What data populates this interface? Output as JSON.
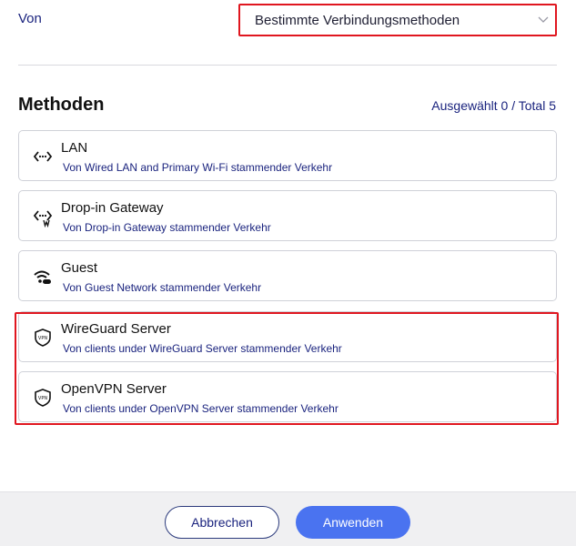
{
  "from": {
    "label": "Von",
    "selected": "Bestimmte Verbindungsmethoden"
  },
  "methods": {
    "title": "Methoden",
    "counter": "Ausgewählt 0 / Total 5",
    "items": [
      {
        "title": "LAN",
        "subtitle": "Von Wired LAN and Primary Wi-Fi stammender Verkehr",
        "icon": "lan-icon"
      },
      {
        "title": "Drop-in Gateway",
        "subtitle": "Von Drop-in Gateway stammender Verkehr",
        "icon": "dropin-gateway-icon"
      },
      {
        "title": "Guest",
        "subtitle": "Von Guest Network stammender Verkehr",
        "icon": "guest-wifi-icon"
      },
      {
        "title": "WireGuard Server",
        "subtitle": "Von clients under WireGuard Server stammender Verkehr",
        "icon": "vpn-shield-icon"
      },
      {
        "title": "OpenVPN Server",
        "subtitle": "Von clients under OpenVPN Server stammender Verkehr",
        "icon": "vpn-shield-icon"
      }
    ]
  },
  "footer": {
    "cancel_label": "Abbrechen",
    "apply_label": "Anwenden"
  },
  "colors": {
    "accent": "#4a73f0",
    "highlight": "#e0161f",
    "text_link": "#1a237e"
  }
}
